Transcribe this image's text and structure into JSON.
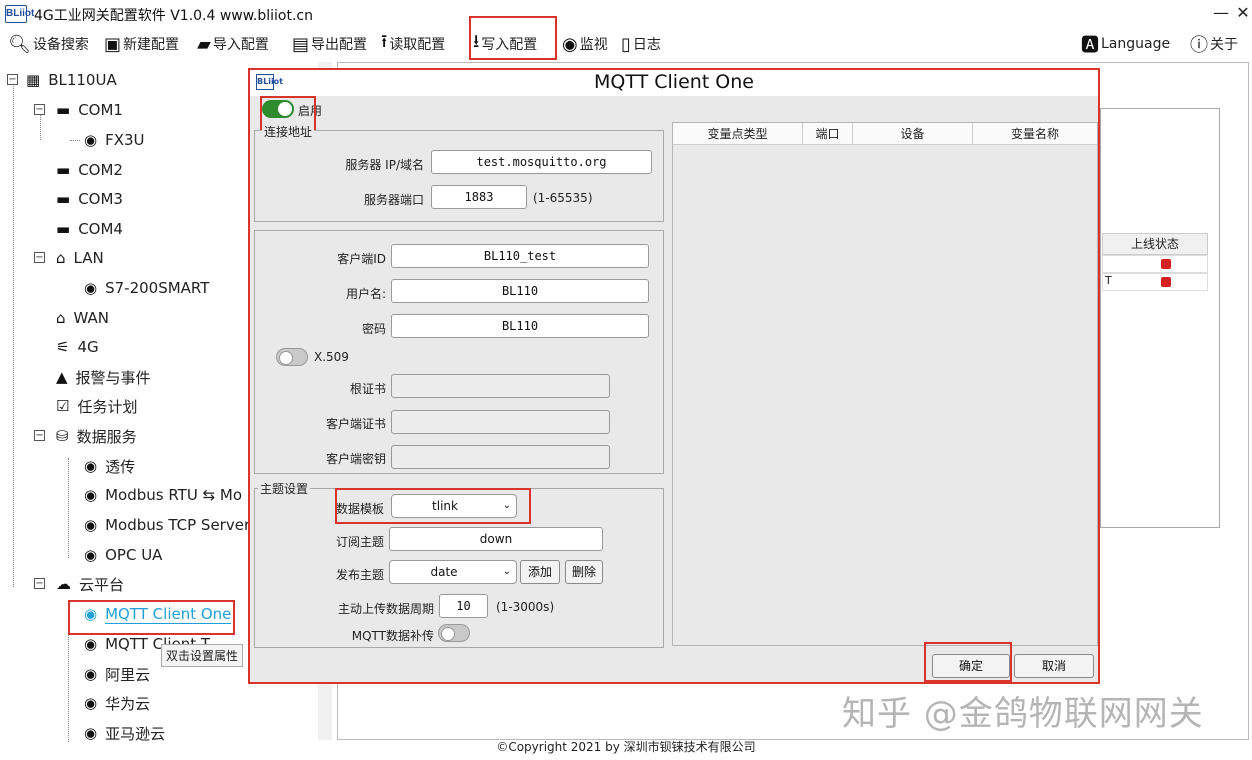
{
  "app": {
    "title": "4G工业网关配置软件 V1.0.4 www.bliiot.cn",
    "icon_text": "BLiiot"
  },
  "window_controls": {
    "minimize": "—",
    "close": "✕"
  },
  "toolbar": {
    "items": [
      {
        "label": "设备搜索",
        "icon": "search-icon"
      },
      {
        "label": "新建配置",
        "icon": "new-config-icon"
      },
      {
        "label": "导入配置",
        "icon": "folder-icon"
      },
      {
        "label": "导出配置",
        "icon": "save-icon"
      },
      {
        "label": "读取配置",
        "icon": "upload-icon"
      },
      {
        "label": "写入配置",
        "icon": "download-icon"
      },
      {
        "label": "监视",
        "icon": "monitor-icon"
      },
      {
        "label": "日志",
        "icon": "log-icon"
      }
    ],
    "language": "Language",
    "about": "关于"
  },
  "tree": {
    "root": "BL110UA",
    "nodes": [
      {
        "label": "COM1"
      },
      {
        "label": "FX3U"
      },
      {
        "label": "COM2"
      },
      {
        "label": "COM3"
      },
      {
        "label": "COM4"
      },
      {
        "label": "LAN"
      },
      {
        "label": "S7-200SMART"
      },
      {
        "label": "WAN"
      },
      {
        "label": "4G"
      },
      {
        "label": "报警与事件"
      },
      {
        "label": "任务计划"
      },
      {
        "label": "数据服务"
      },
      {
        "label": "透传"
      },
      {
        "label": "Modbus RTU ⇆ Mo"
      },
      {
        "label": "Modbus TCP Server"
      },
      {
        "label": "OPC UA"
      },
      {
        "label": "云平台"
      },
      {
        "label": "MQTT Client One"
      },
      {
        "label": "MQTT Client T"
      },
      {
        "label": "阿里云"
      },
      {
        "label": "华为云"
      },
      {
        "label": "亚马逊云"
      }
    ],
    "tooltip": "双击设置属性"
  },
  "background_panel": {
    "status_header": "上线状态",
    "row_fragment": "T",
    "status_color": "#d42020"
  },
  "dialog": {
    "title": "MQTT Client One",
    "enable_label": "启用",
    "connection": {
      "group_title": "连接地址",
      "server_label": "服务器 IP/域名",
      "server_value": "test.mosquitto.org",
      "port_label": "服务器端口",
      "port_value": "1883",
      "port_hint": "(1-65535)"
    },
    "auth": {
      "client_id_label": "客户端ID",
      "client_id_value": "BL110_test",
      "username_label": "用户名:",
      "username_value": "BL110",
      "password_label": "密码",
      "password_value": "BL110",
      "x509_label": "X.509",
      "root_cert_label": "根证书",
      "client_cert_label": "客户端证书",
      "client_key_label": "客户端密钥"
    },
    "topic": {
      "group_title": "主题设置",
      "template_label": "数据模板",
      "template_value": "tlink",
      "subscribe_label": "订阅主题",
      "subscribe_value": "down",
      "publish_label": "发布主题",
      "publish_value": "date",
      "add_button": "添加",
      "delete_button": "删除",
      "period_label": "主动上传数据周期",
      "period_value": "10",
      "period_hint": "(1-3000s)",
      "resend_label": "MQTT数据补传"
    },
    "var_table": {
      "columns": [
        "变量点类型",
        "端口",
        "设备",
        "变量名称"
      ]
    },
    "ok_button": "确定",
    "cancel_button": "取消"
  },
  "footer": "©Copyright 2021 by 深圳市钡铼技术有限公司",
  "watermark": "知乎 @金鸽物联网网关",
  "colors": {
    "highlight_red": "#d9342b",
    "toggle_on": "#2e8b2e",
    "selected_text": "#1f9fd8"
  }
}
